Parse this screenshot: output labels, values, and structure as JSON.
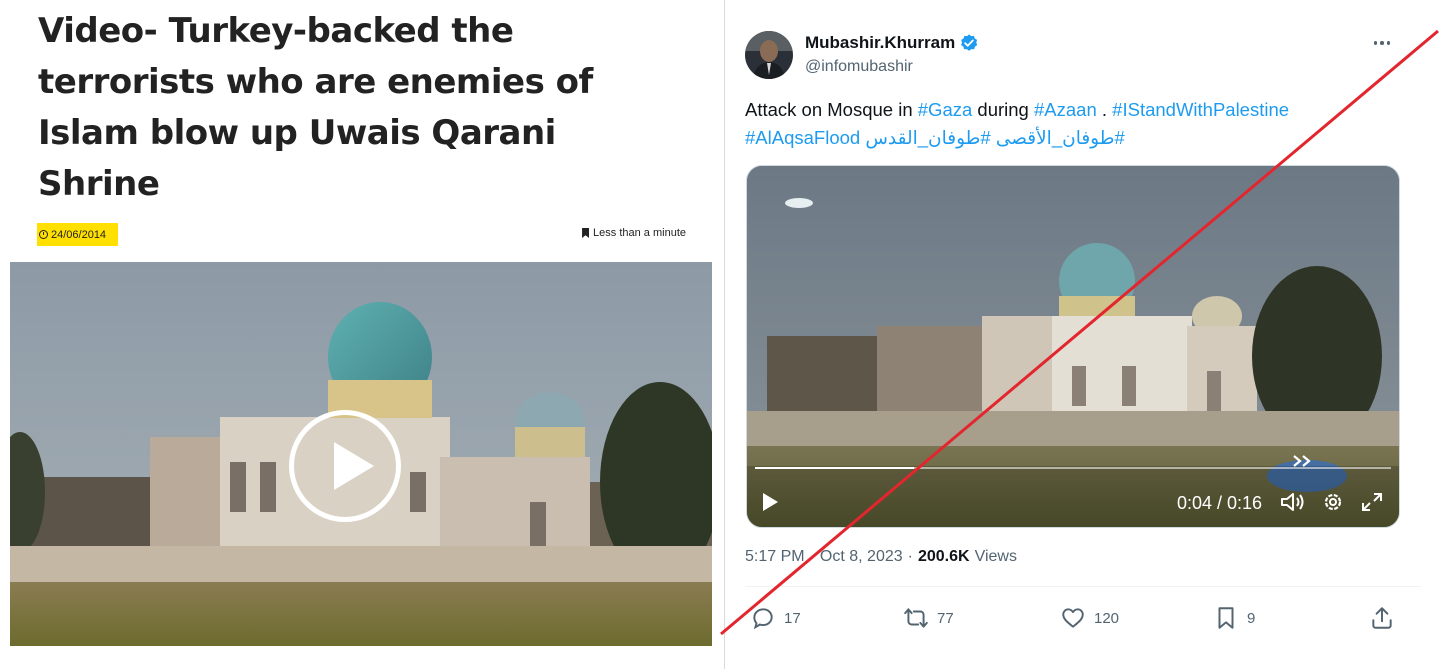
{
  "article": {
    "headline_lines": [
      "Video- Turkey-backed the",
      "terrorists who are enemies of",
      "Islam blow up Uwais Qarani",
      "Shrine"
    ],
    "date": "24/06/2014",
    "reading_time": "Less than a minute",
    "icons": {
      "date": "clock-icon",
      "reading_time": "bookmark-icon",
      "video": "play-icon"
    }
  },
  "tweet": {
    "display_name": "Mubashir.Khurram",
    "handle": "@infomubashir",
    "verified": true,
    "text": {
      "part1": "Attack on Mosque in ",
      "tag_gaza": "#Gaza",
      "part2": " during ",
      "tag_azaan": "#Azaan",
      "part3": " . ",
      "tag_stand": "#IStandWithPalestine",
      "tag_flood": "#AlAqsaFlood",
      "tag_arabic_1": "#طوفان_الأقصى",
      "tag_arabic_2": "#طوفان_القدس"
    },
    "video": {
      "current_time": "0:04",
      "duration": "0:16",
      "time_display": "0:04 / 0:16",
      "progress": 0.25,
      "controls": [
        "play-icon",
        "volume-icon",
        "settings-icon",
        "fullscreen-icon"
      ]
    },
    "time": "5:17 PM",
    "date": "Oct 8, 2023",
    "views_count": "200.6K",
    "views_label": "Views",
    "separator": "·",
    "actions": {
      "replies": "17",
      "retweets": "77",
      "likes": "120",
      "bookmarks": "9"
    },
    "colors": {
      "link": "#1d9bf0",
      "muted": "#536471",
      "verified": "#1d9bf0"
    }
  },
  "overlay": {
    "slash_color": "#e3262e"
  }
}
